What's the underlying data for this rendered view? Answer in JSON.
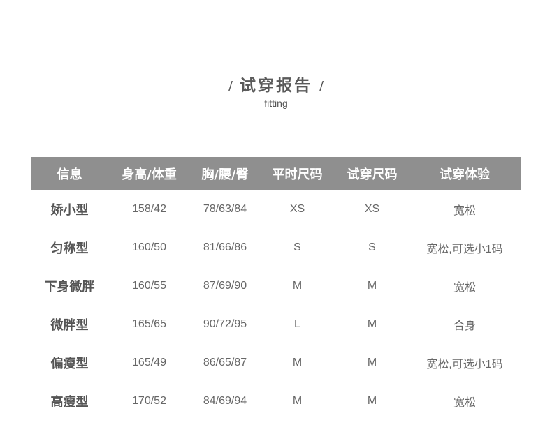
{
  "title": "试穿报告",
  "slash_left": "/",
  "slash_right": "/",
  "subtitle": "fitting",
  "table": {
    "headers": [
      "信息",
      "身高/体重",
      "胸/腰/臀",
      "平时尺码",
      "试穿尺码",
      "试穿体验"
    ],
    "rows": [
      [
        "娇小型",
        "158/42",
        "78/63/84",
        "XS",
        "XS",
        "宽松"
      ],
      [
        "匀称型",
        "160/50",
        "81/66/86",
        "S",
        "S",
        "宽松,可选小1码"
      ],
      [
        "下身微胖",
        "160/55",
        "87/69/90",
        "M",
        "M",
        "宽松"
      ],
      [
        "微胖型",
        "165/65",
        "90/72/95",
        "L",
        "M",
        "合身"
      ],
      [
        "偏瘦型",
        "165/49",
        "86/65/87",
        "M",
        "M",
        "宽松,可选小1码"
      ],
      [
        "高瘦型",
        "170/52",
        "84/69/94",
        "M",
        "M",
        "宽松"
      ]
    ]
  },
  "colors": {
    "header_bg": "#8f8f8f",
    "header_text": "#ffffff",
    "body_text": "#666666"
  }
}
